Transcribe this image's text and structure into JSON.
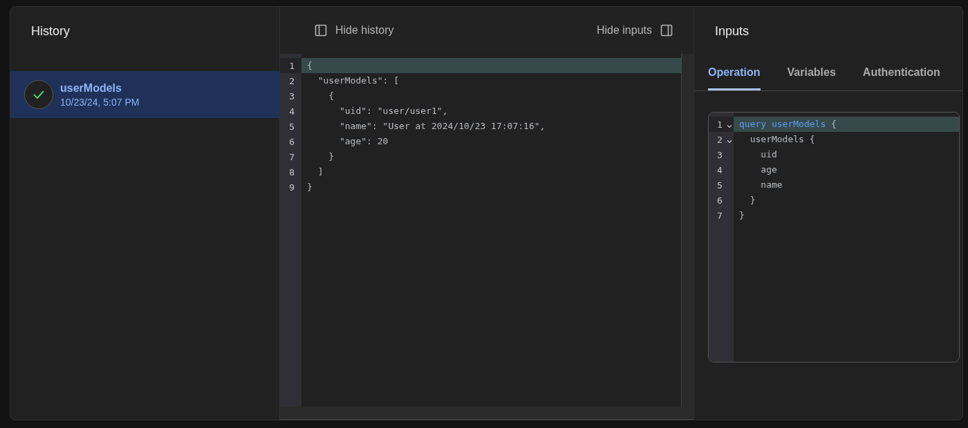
{
  "history": {
    "title": "History",
    "items": [
      {
        "name": "userModels",
        "time": "10/23/24, 5:07 PM",
        "selected": true,
        "succeeded": true
      }
    ]
  },
  "result": {
    "hide_history": "Hide history",
    "hide_inputs": "Hide inputs",
    "lines": [
      {
        "number": "1",
        "active": true,
        "text": "{"
      },
      {
        "number": "2",
        "active": false,
        "text": "  \"userModels\": ["
      },
      {
        "number": "3",
        "active": false,
        "text": "    {"
      },
      {
        "number": "4",
        "active": false,
        "text": "      \"uid\": \"user/user1\","
      },
      {
        "number": "5",
        "active": false,
        "text": "      \"name\": \"User at 2024/10/23 17:07:16\","
      },
      {
        "number": "6",
        "active": false,
        "text": "      \"age\": 20"
      },
      {
        "number": "7",
        "active": false,
        "text": "    }"
      },
      {
        "number": "8",
        "active": false,
        "text": "  ]"
      },
      {
        "number": "9",
        "active": false,
        "text": "}"
      }
    ]
  },
  "inputs": {
    "title": "Inputs",
    "tabs": [
      {
        "label": "Operation",
        "selected": true
      },
      {
        "label": "Variables",
        "selected": false
      },
      {
        "label": "Authentication",
        "selected": false
      }
    ],
    "lines": [
      {
        "number": "1",
        "active": true,
        "foldable": true,
        "tokens": [
          {
            "text": "query userModels",
            "kind": "keyword"
          },
          {
            "text": " {",
            "kind": "plain"
          }
        ]
      },
      {
        "number": "2",
        "active": false,
        "foldable": true,
        "tokens": [
          {
            "text": "  userModels {",
            "kind": "plain"
          }
        ]
      },
      {
        "number": "3",
        "active": false,
        "foldable": false,
        "tokens": [
          {
            "text": "    uid",
            "kind": "plain"
          }
        ]
      },
      {
        "number": "4",
        "active": false,
        "foldable": false,
        "tokens": [
          {
            "text": "    age",
            "kind": "plain"
          }
        ]
      },
      {
        "number": "5",
        "active": false,
        "foldable": false,
        "tokens": [
          {
            "text": "    name",
            "kind": "plain"
          }
        ]
      },
      {
        "number": "6",
        "active": false,
        "foldable": false,
        "tokens": [
          {
            "text": "  }",
            "kind": "plain"
          }
        ]
      },
      {
        "number": "7",
        "active": false,
        "foldable": false,
        "tokens": [
          {
            "text": "}",
            "kind": "plain"
          }
        ]
      }
    ]
  }
}
